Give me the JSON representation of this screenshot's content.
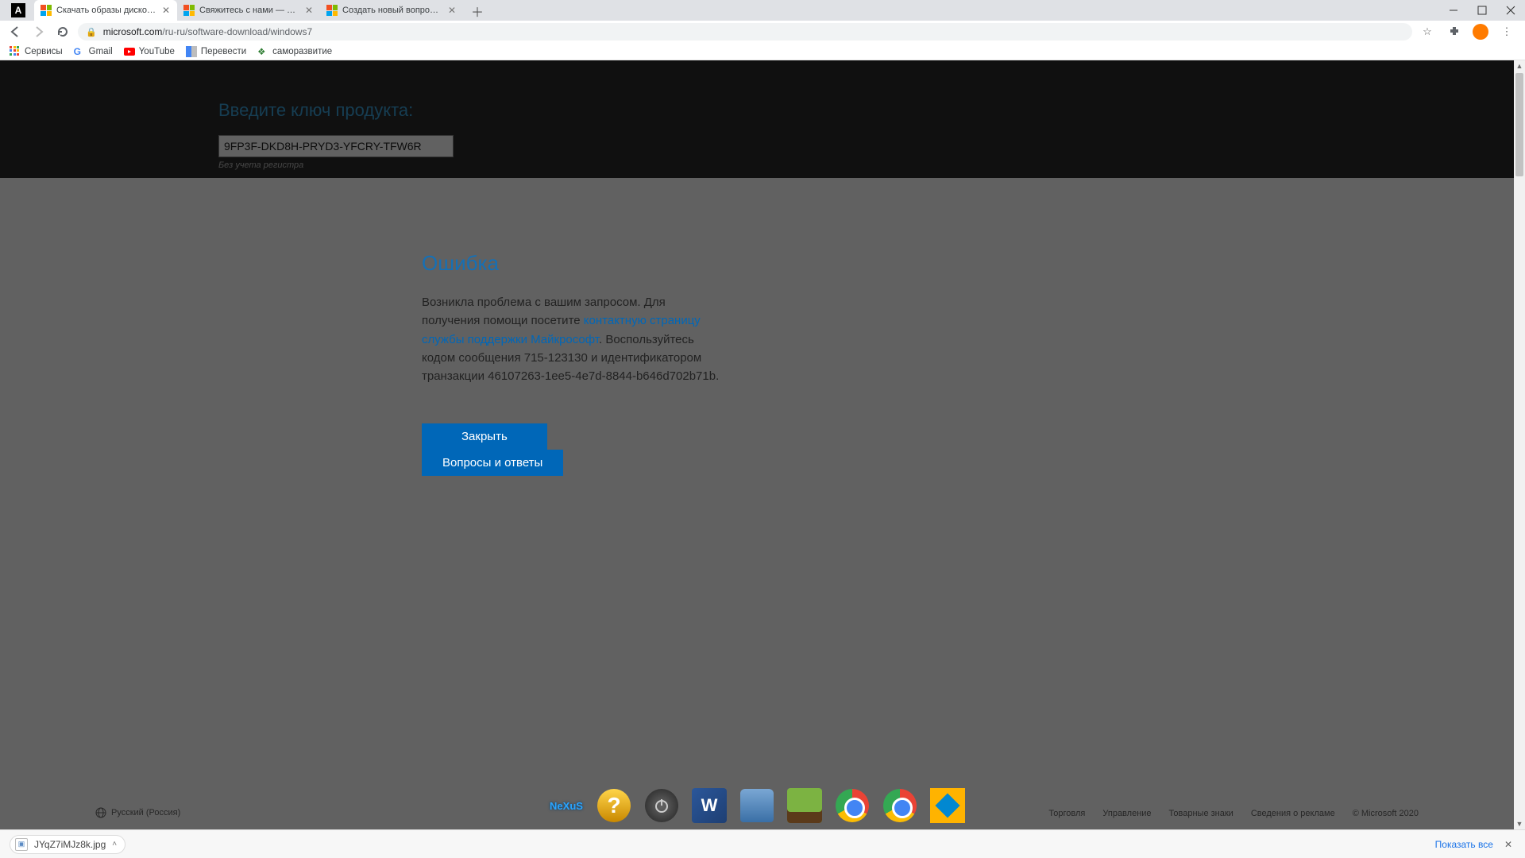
{
  "browser": {
    "tabs": [
      {
        "title": "Скачать образы дисков с Wind",
        "active": true
      },
      {
        "title": "Свяжитесь с нами — служба по",
        "active": false
      },
      {
        "title": "Создать новый вопрос или нач",
        "active": false
      }
    ],
    "url_host": "microsoft.com",
    "url_path": "/ru-ru/software-download/windows7",
    "bookmarks": [
      "Сервисы",
      "Gmail",
      "YouTube",
      "Перевести",
      "саморазвитие"
    ]
  },
  "page": {
    "product_key": {
      "title": "Введите ключ продукта:",
      "value": "9FP3F-DKD8H-PRYD3-YFCRY-TFW6R",
      "note": "Без учета регистра"
    },
    "error": {
      "title": "Ошибка",
      "text_before_link": "Возникла проблема с вашим запросом. Для получения помощи посетите ",
      "link_text": "контактную страницу службы поддержки Майкрософт",
      "text_after_link": ". Воспользуйтесь кодом сообщения 715-123130 и идентификатором транзакции 46107263-1ee5-4e7d-8844-b646d702b71b.",
      "btn_close": "Закрыть",
      "btn_faq": "Вопросы и ответы"
    },
    "footer": {
      "language": "Русский (Россия)",
      "links": [
        "Торговля",
        "Управление",
        "Товарные знаки",
        "Сведения о рекламе"
      ],
      "copyright": "© Microsoft 2020"
    }
  },
  "dock": {
    "apps": [
      "nexus",
      "help",
      "power",
      "word",
      "recycle-bin",
      "minecraft",
      "chrome",
      "chrome-2",
      "geometry-dash"
    ]
  },
  "shelf": {
    "download_filename": "JYqZ7iMJz8k.jpg",
    "show_all": "Показать все"
  }
}
